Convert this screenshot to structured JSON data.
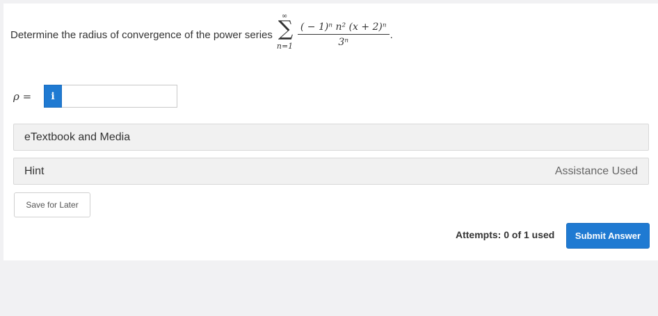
{
  "question": {
    "text": "Determine the radius of convergence of the power series",
    "sum_upper": "∞",
    "sum_symbol": "∑",
    "sum_lower": "n=1",
    "numerator": "( − 1)ⁿ n² (x + 2)ⁿ",
    "denominator": "3ⁿ",
    "period": "."
  },
  "answer": {
    "variable_label": "ρ =",
    "info_icon": "i",
    "value": ""
  },
  "panels": {
    "etextbook_label": "eTextbook and Media",
    "hint_label": "Hint",
    "assistance_label": "Assistance Used"
  },
  "actions": {
    "save_label": "Save for Later",
    "attempts_text": "Attempts: 0 of 1 used",
    "submit_label": "Submit Answer"
  },
  "colors": {
    "accent": "#1f7ad2",
    "panel_bg": "#f1f1f1",
    "page_bg": "#f1f1f3"
  }
}
